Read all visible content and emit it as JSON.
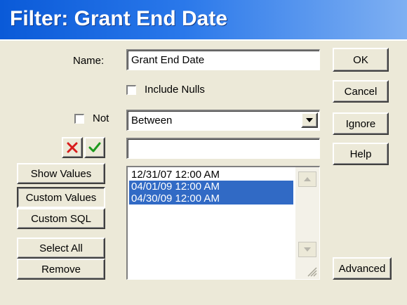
{
  "window": {
    "title": "Filter: Grant End Date"
  },
  "form": {
    "name_label": "Name:",
    "name_value": "Grant End Date",
    "include_nulls_label": "Include Nulls",
    "not_label": "Not",
    "operator_value": "Between",
    "value_input": ""
  },
  "side_buttons": {
    "show_values": "Show Values",
    "custom_values": "Custom Values",
    "custom_sql": "Custom SQL",
    "select_all": "Select All",
    "remove": "Remove"
  },
  "right_buttons": {
    "ok": "OK",
    "cancel": "Cancel",
    "ignore": "Ignore",
    "help": "Help",
    "advanced": "Advanced"
  },
  "values_list": [
    {
      "text": "12/31/07 12:00 AM",
      "selected": false
    },
    {
      "text": "04/01/09 12:00 AM",
      "selected": true
    },
    {
      "text": "04/30/09 12:00 AM",
      "selected": true
    }
  ],
  "icons": {
    "reject": "red-x-icon",
    "accept": "green-check-icon"
  },
  "colors": {
    "title_bar": "#0a5ad8",
    "selection": "#316ac5",
    "reject": "#d81c1c",
    "accept": "#1e9a1e"
  }
}
